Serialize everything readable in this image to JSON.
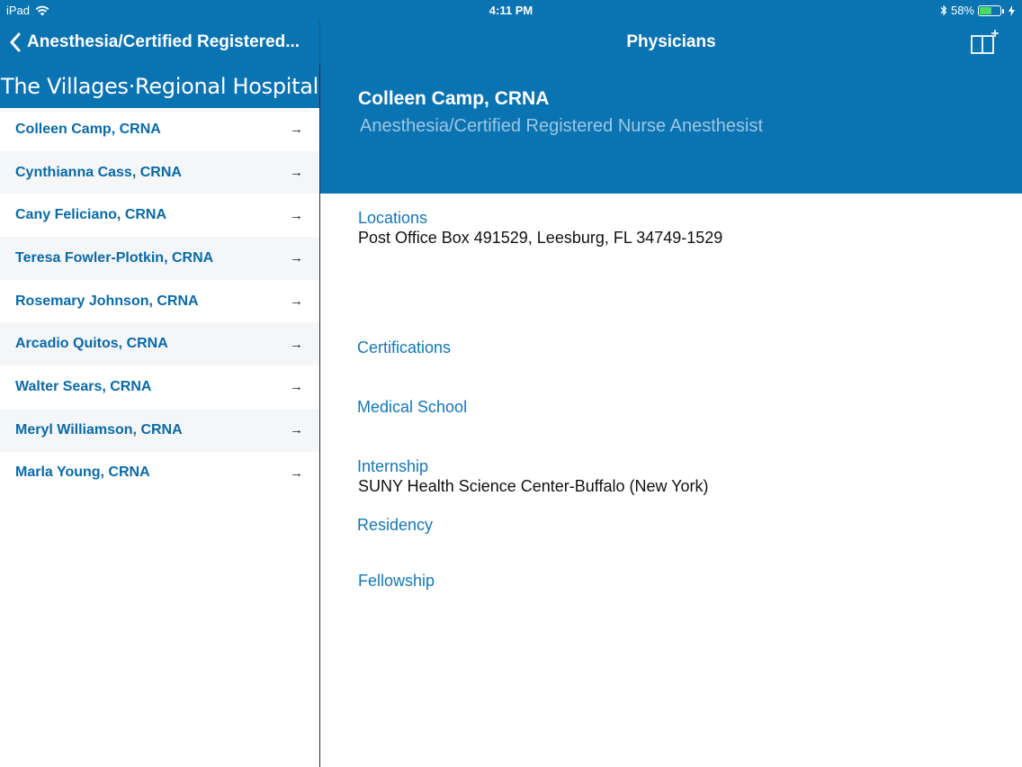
{
  "status_bar": {
    "device": "iPad",
    "time": "4:11 PM",
    "battery_percent": "58%",
    "battery_level": 0.58
  },
  "nav": {
    "back_label": "Anesthesia/Certified Registered...",
    "title": "Physicians"
  },
  "sidebar": {
    "hospital_name": "The Villages·Regional Hospital",
    "items": [
      {
        "name": "Colleen Camp, CRNA"
      },
      {
        "name": "Cynthianna Cass, CRNA"
      },
      {
        "name": "Cany Feliciano, CRNA"
      },
      {
        "name": "Teresa Fowler-Plotkin, CRNA"
      },
      {
        "name": "Rosemary Johnson, CRNA"
      },
      {
        "name": "Arcadio Quitos, CRNA"
      },
      {
        "name": "Walter Sears, CRNA"
      },
      {
        "name": "Meryl Williamson, CRNA"
      },
      {
        "name": "Marla Young, CRNA"
      }
    ],
    "arrow": "→"
  },
  "detail": {
    "name": "Colleen Camp, CRNA",
    "specialty": "Anesthesia/Certified Registered Nurse Anesthesist",
    "locations_label": "Locations",
    "locations_value": "Post Office Box 491529, Leesburg, FL 34749-1529",
    "certifications_label": "Certifications",
    "medical_school_label": "Medical School",
    "internship_label": "Internship",
    "internship_value": "SUNY Health Science Center-Buffalo (New York)",
    "residency_label": "Residency",
    "fellowship_label": "Fellowship"
  },
  "colors": {
    "brand_blue": "#0a73b2",
    "link_blue": "#0a6aa6",
    "battery_green": "#4cd964"
  }
}
